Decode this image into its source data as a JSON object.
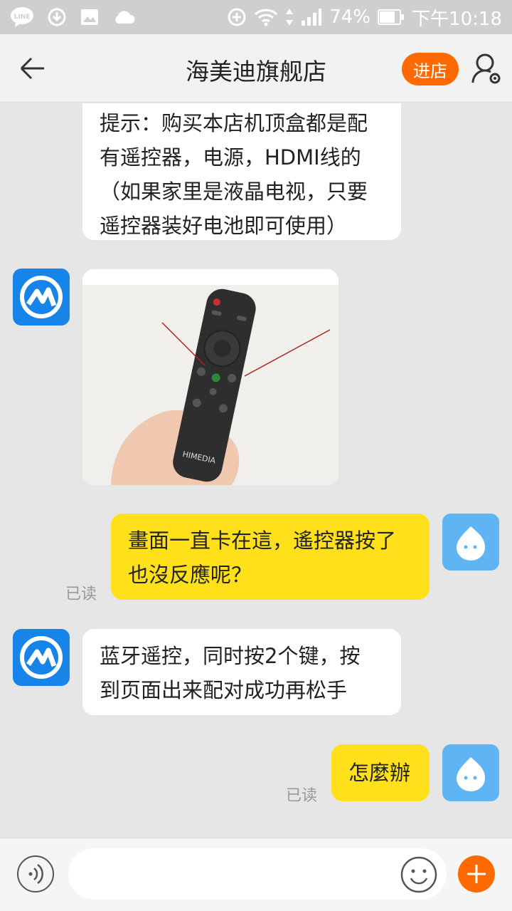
{
  "status_bar": {
    "battery_text": "74%",
    "time": "下午10:18",
    "line_label": "LINE"
  },
  "header": {
    "title": "海美迪旗舰店",
    "enter_store_label": "进店"
  },
  "messages": [
    {
      "sender": "store",
      "type": "text",
      "lines": [
        "提示：购买本店机顶盒都是配",
        "有遥控器，电源，HDMI线的",
        "（如果家里是液晶电视，只要",
        "遥控器装好电池即可使用）"
      ]
    },
    {
      "sender": "store",
      "type": "image",
      "image_text": "HIMEDIA"
    },
    {
      "sender": "user",
      "type": "text",
      "lines": [
        "畫面一直卡在這，遙控器按了",
        "也沒反應呢？"
      ],
      "status": "已读"
    },
    {
      "sender": "store",
      "type": "text",
      "lines": [
        "蓝牙遥控，同时按2个键，按",
        "到页面出来配对成功再松手"
      ]
    },
    {
      "sender": "user",
      "type": "text",
      "lines": [
        "怎麼辦"
      ],
      "status": "已读"
    }
  ],
  "input": {
    "placeholder": "",
    "value": ""
  },
  "colors": {
    "accent": "#ff6a00",
    "user_bubble": "#ffe01a",
    "store_avatar": "#1784ea",
    "user_avatar": "#5fb5f4"
  }
}
